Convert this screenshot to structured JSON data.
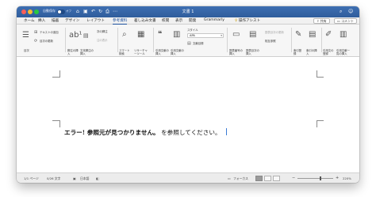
{
  "titlebar": {
    "autosave_label": "自動保存",
    "toggle_label": "オフ",
    "doc_title": "文書 1",
    "icons": [
      "home-icon",
      "save-icon",
      "undo-icon",
      "redo-icon",
      "print-icon",
      "more-icon",
      "search-icon",
      "person-icon"
    ]
  },
  "tabs": {
    "items": [
      "ホーム",
      "挿入",
      "描画",
      "デザイン",
      "レイアウト",
      "参考資料",
      "差し込み文書",
      "校閲",
      "表示",
      "開発",
      "Grammarly",
      "操作アシスト"
    ],
    "active": "参考資料",
    "share_label": "共有",
    "comment_label": "コメント"
  },
  "ribbon": {
    "toc_label": "目次",
    "add_text_label": "テキストの追加",
    "update_table_label": "目次の更新",
    "footnote_label": "脚注の挿入",
    "endnote_label": "文末脚注の挿入",
    "next_footnote_label": "次の脚注",
    "show_notes_label": "注の表示",
    "smart_lookup_label": "スマート検索",
    "researcher_label": "リサーチャーツール",
    "insert_citation_label": "引用文献の挿入",
    "bibliography_label": "引用文献の挿入",
    "style_label": "スタイル",
    "style_value": "APA",
    "bibliography_list_label": "文献目録",
    "insert_caption_label": "図表番号の挿入",
    "insert_table_of_figures_label": "図表目次の挿入",
    "update_table_of_figures_label": "図表目次の更新",
    "cross_reference_label": "相互参照",
    "mark_entry_label": "索引登録",
    "insert_index_label": "索引の挿入",
    "mark_citation_label": "引用文の登録",
    "insert_toa_label": "引用文献一覧の挿入"
  },
  "document": {
    "error_text": "エラー! 参照元が見つかりません。",
    "rest_text": "を参照してください。"
  },
  "status": {
    "page_count": "1/1 ページ",
    "word_count": "0/26 文字",
    "language": "日本語",
    "focus_label": "フォーカス",
    "zoom": "220%"
  },
  "colors": {
    "titlebar": "#2f5d9c",
    "accent": "#1a4e9c",
    "cursor": "#3a7bd5"
  }
}
